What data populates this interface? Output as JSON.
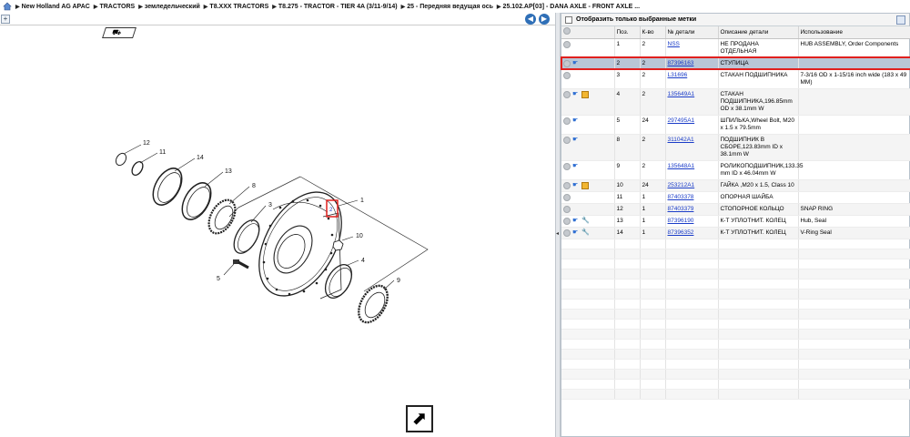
{
  "breadcrumbs": [
    "New Holland AG APAC",
    "TRACTORS",
    "земледельческий",
    "T8.XXX TRACTORS",
    "T8.275 - TRACTOR - TIER 4A (3/11-9/14)",
    "25 - Передняя ведущая ось",
    "25.102.AP[03] - DANA AXLE - FRONT AXLE ..."
  ],
  "diagram": {
    "callouts": [
      "12",
      "11",
      "14",
      "13",
      "8",
      "3",
      "1",
      "10",
      "4",
      "9",
      "5"
    ],
    "truck_icon": "truck-icon",
    "highlight_label": "2"
  },
  "filter": {
    "label": "Отобразить только выбранные метки"
  },
  "table": {
    "columns": [
      "Поз.",
      "К-во",
      "№ детали",
      "Описание детали",
      "Использование"
    ],
    "rows": [
      {
        "pos": "1",
        "qty": "2",
        "part": "NSS",
        "desc": "НЕ ПРОДАНА ОТДЕЛЬНАЯ",
        "usage": "HUB ASSEMBLY, Order Components",
        "icons": [
          "circle"
        ]
      },
      {
        "pos": "2",
        "qty": "2",
        "part": "87396163",
        "desc": "СТУПИЦА",
        "usage": "",
        "icons": [
          "circle",
          "hand"
        ],
        "selected": true
      },
      {
        "pos": "3",
        "qty": "2",
        "part": "L31696",
        "desc": "СТАКАН ПОДШИПНИКА",
        "usage": "7-3/16 OD x 1-15/16 inch wide (183 x 49 MM)",
        "icons": [
          "circle"
        ]
      },
      {
        "pos": "4",
        "qty": "2",
        "part": "135649A1",
        "desc": "СТАКАН ПОДШИПНИКА,196.85mm OD x 38.1mm W",
        "usage": "",
        "icons": [
          "circle",
          "hand",
          "box"
        ]
      },
      {
        "pos": "5",
        "qty": "24",
        "part": "297495A1",
        "desc": "ШПИЛЬКА,Wheel Bolt, M20 x 1.5 x 79.5mm",
        "usage": "",
        "icons": [
          "circle",
          "hand"
        ]
      },
      {
        "pos": "8",
        "qty": "2",
        "part": "311042A1",
        "desc": "ПОДШИПНИК В СБОРЕ,123.83mm ID x 38.1mm W",
        "usage": "",
        "icons": [
          "circle",
          "hand"
        ]
      },
      {
        "pos": "9",
        "qty": "2",
        "part": "135648A1",
        "desc": "РОЛИКОПОДШИПНИК,133.35 mm ID x 46.04mm W",
        "usage": "",
        "icons": [
          "circle",
          "hand"
        ]
      },
      {
        "pos": "10",
        "qty": "24",
        "part": "253212A1",
        "desc": "ГАЙКА ,M20 x 1.5, Class 10",
        "usage": "",
        "icons": [
          "circle",
          "hand",
          "box"
        ]
      },
      {
        "pos": "11",
        "qty": "1",
        "part": "87403378",
        "desc": "ОПОРНАЯ ШАЙБА",
        "usage": "",
        "icons": [
          "circle"
        ]
      },
      {
        "pos": "12",
        "qty": "1",
        "part": "87403379",
        "desc": "СТОПОРНОЕ КОЛЬЦО",
        "usage": "SNAP RING",
        "icons": [
          "circle"
        ]
      },
      {
        "pos": "13",
        "qty": "1",
        "part": "87396190",
        "desc": "К-Т УПЛОТНИТ. КОЛЕЦ",
        "usage": "Hub, Seal",
        "icons": [
          "circle",
          "hand",
          "wrench"
        ]
      },
      {
        "pos": "14",
        "qty": "1",
        "part": "87396352",
        "desc": "К-Т УПЛОТНИТ. КОЛЕЦ",
        "usage": "V-Ring Seal",
        "icons": [
          "circle",
          "hand",
          "wrench"
        ]
      }
    ]
  },
  "colors": {
    "selection_outline": "#e0201e",
    "selection_fill": "#b9c6d6",
    "link": "#1a3cc8",
    "nav_button": "#2f6fb7"
  }
}
